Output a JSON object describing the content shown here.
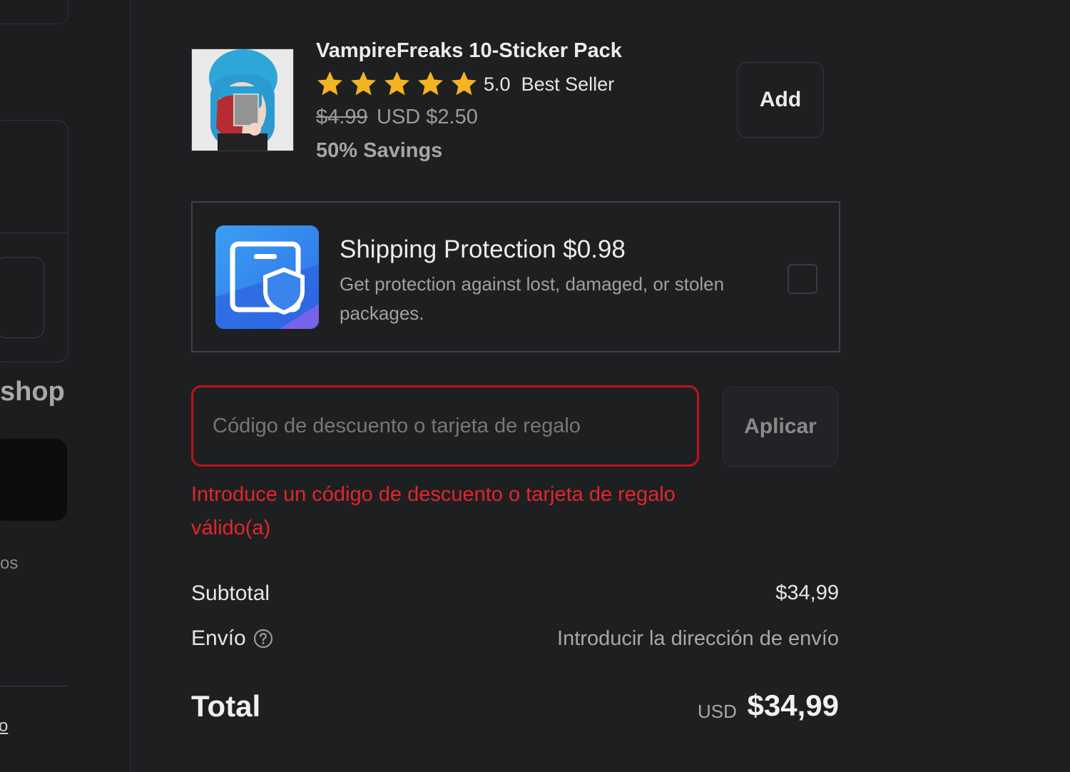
{
  "left_pane": {
    "shop_text": "shop",
    "os_text": "os",
    "link_text": "o"
  },
  "product": {
    "title": "VampireFreaks 10-Sticker Pack",
    "rating": "5.0",
    "rating_stars": 5,
    "badge": "Best Seller",
    "old_price": "$4.99",
    "new_price": "USD $2.50",
    "savings": "50%  Savings",
    "add_label": "Add",
    "icons": [
      "star-icon"
    ]
  },
  "protection": {
    "title": "Shipping Protection $0.98",
    "description": "Get protection against lost, damaged, or stolen packages.",
    "icon": "shipping-protection-shield-icon",
    "checked": false
  },
  "discount": {
    "placeholder": "Código de descuento o tarjeta de regalo",
    "value": "",
    "apply_label": "Aplicar",
    "error": "Introduce un código de descuento o tarjeta de regalo válido(a)",
    "error_color": "#e0262d"
  },
  "summary": {
    "subtotal_label": "Subtotal",
    "subtotal_value": "$34,99",
    "shipping_label": "Envío",
    "shipping_value": "Introducir la dirección de envío",
    "total_label": "Total",
    "currency": "USD",
    "total_value": "$34,99"
  }
}
